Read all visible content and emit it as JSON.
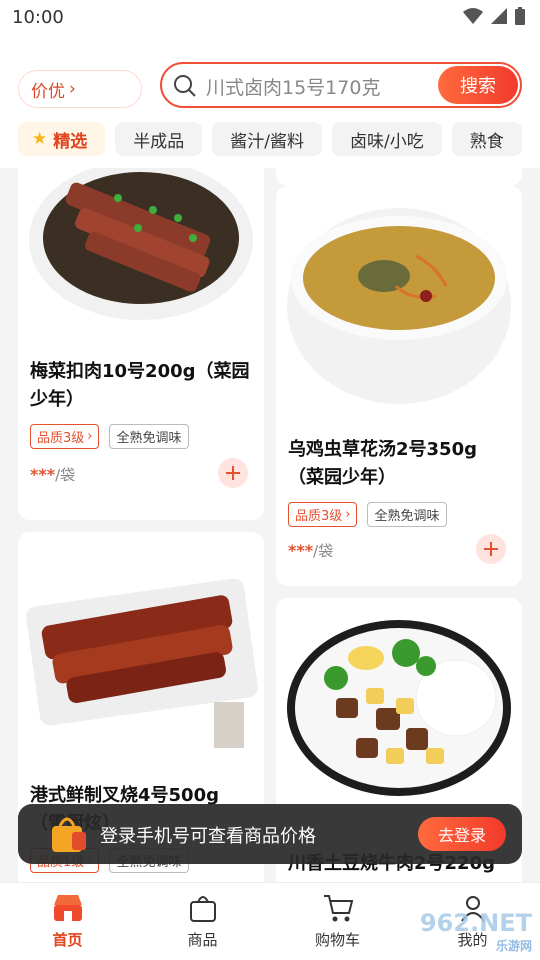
{
  "status_bar": {
    "time": "10:00"
  },
  "header": {
    "price_filter": "价优",
    "search": {
      "placeholder": "川式卤肉15号170克",
      "button": "搜索"
    },
    "tabs": [
      {
        "label": "精选",
        "active": true
      },
      {
        "label": "半成品"
      },
      {
        "label": "酱汁/酱料"
      },
      {
        "label": "卤味/小吃"
      },
      {
        "label": "熟食"
      }
    ]
  },
  "products": [
    {
      "name": "梅菜扣肉10号200g（菜园少年）",
      "quality": "品质3级",
      "tag": "全熟免调味",
      "price": "***",
      "unit": "/袋"
    },
    {
      "name": "乌鸡虫草花汤2号350g（菜园少年）",
      "quality": "品质3级",
      "tag": "全熟免调味",
      "price": "***",
      "unit": "/袋"
    },
    {
      "name": "港式鲜制叉烧4号500g（雪厨炫）",
      "quality": "品质1级",
      "tag": "全熟免调味"
    },
    {
      "name": "川香土豆烧牛肉2号220g"
    }
  ],
  "login_banner": {
    "message": "登录手机号可查看商品价格",
    "button": "去登录"
  },
  "bottom_nav": [
    {
      "label": "首页",
      "icon": "shop-icon",
      "active": true
    },
    {
      "label": "商品",
      "icon": "bag-icon"
    },
    {
      "label": "购物车",
      "icon": "cart-icon"
    },
    {
      "label": "我的",
      "icon": "user-icon"
    }
  ],
  "watermark": {
    "logo": "962.NET",
    "text": "乐游网"
  },
  "colors": {
    "accent": "#f23a2b",
    "accent_light": "#ff6a3d"
  }
}
